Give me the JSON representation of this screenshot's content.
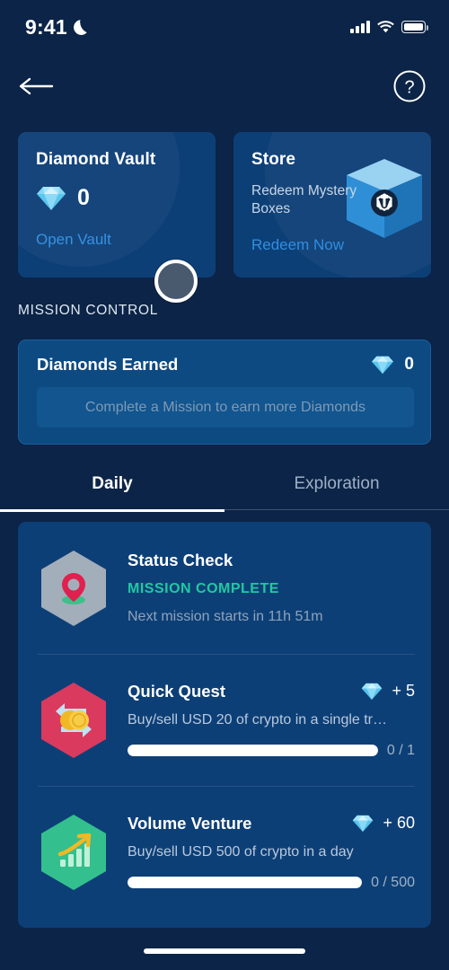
{
  "status_bar": {
    "time": "9:41",
    "dnd_icon": "moon-icon",
    "signal_icon": "cellular-signal-icon",
    "wifi_icon": "wifi-icon",
    "battery_icon": "battery-full-icon"
  },
  "nav": {
    "back_icon": "back-arrow-icon",
    "help_icon": "help-question-icon"
  },
  "top_cards": {
    "vault": {
      "title": "Diamond Vault",
      "gem_icon": "diamond-icon",
      "amount": "0",
      "link": "Open Vault"
    },
    "store": {
      "title": "Store",
      "subtitle": "Redeem Mystery Boxes",
      "link": "Redeem Now",
      "box_icon": "mystery-box-icon"
    }
  },
  "mission_control": {
    "heading": "MISSION CONTROL",
    "earned": {
      "title": "Diamonds Earned",
      "gem_icon": "diamond-icon",
      "amount": "0",
      "banner": "Complete a Mission to earn more Diamonds"
    }
  },
  "tabs": [
    {
      "label": "Daily",
      "active": true
    },
    {
      "label": "Exploration",
      "active": false
    }
  ],
  "missions": [
    {
      "title": "Status Check",
      "icon": "location-pin-hex-icon",
      "icon_color": "#a3aebb",
      "status": "MISSION COMPLETE",
      "subtext": "Next mission starts in 11h 51m",
      "reward": "",
      "progress_label": "",
      "progress_percent": 0
    },
    {
      "title": "Quick Quest",
      "icon": "coin-swap-hex-icon",
      "icon_color": "#d93a5e",
      "description": "Buy/sell USD 20 of crypto in a single tr…",
      "reward": "+ 5",
      "progress_label": "0 / 1",
      "progress_percent": 100
    },
    {
      "title": "Volume Venture",
      "icon": "growth-chart-hex-icon",
      "icon_color": "#33c08e",
      "description": "Buy/sell USD 500 of crypto in a day",
      "reward": "+ 60",
      "progress_label": "0 / 500",
      "progress_percent": 100
    }
  ],
  "cursor": {
    "name": "touch-cursor"
  },
  "home_indicator": "home-indicator",
  "colors": {
    "background": "#0b2447",
    "card": "#0d3f77",
    "card_light": "#0d4a82",
    "link": "#2f8fe0",
    "success": "#20c9a0",
    "diamond": "#8fd8f5"
  }
}
